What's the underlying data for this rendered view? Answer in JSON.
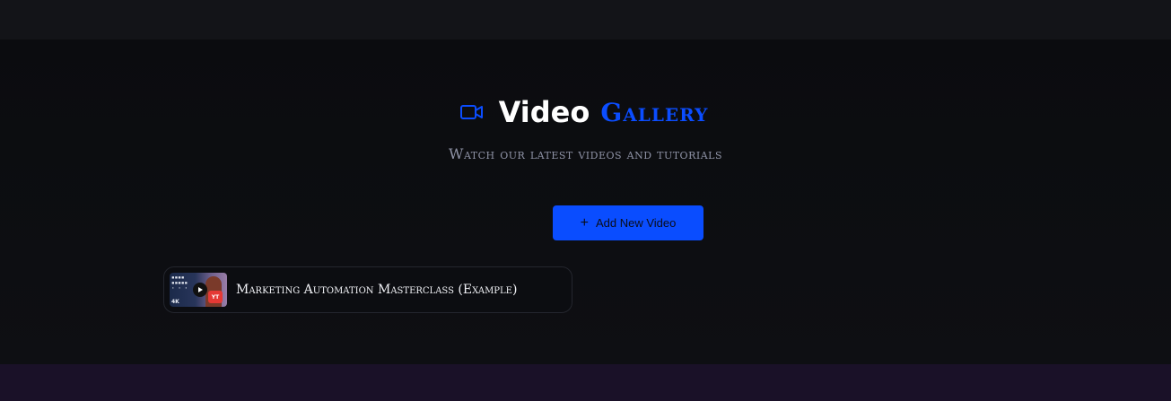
{
  "header": {
    "title_word1": "Video",
    "title_word2": "Gallery",
    "icon": "video-camera-icon",
    "subtitle": "Watch our latest videos and tutorials"
  },
  "actions": {
    "add_video_label": "Add New Video",
    "add_icon": "plus-icon"
  },
  "videos": [
    {
      "title": "Marketing Automation Masterclass (Example)",
      "thumbnail_badge": "YT",
      "thumbnail_corner_text": "4K"
    }
  ],
  "colors": {
    "accent": "#0a4dff",
    "background": "#0b0c10",
    "topbar": "#131418",
    "footer": "#1a1128",
    "subtitle": "#8f93a6"
  }
}
